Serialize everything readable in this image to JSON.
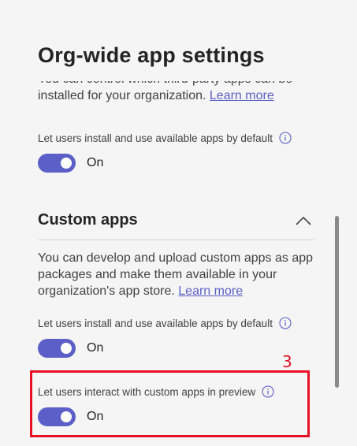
{
  "page": {
    "title": "Org-wide app settings"
  },
  "third_party": {
    "description": "You can control which third-party apps can be installed for your organization.",
    "learn_more": "Learn more",
    "setting_label": "Let users install and use available apps by default",
    "toggle_state": "On",
    "toggle_on": true
  },
  "custom_apps": {
    "heading": "Custom apps",
    "description": "You can develop and upload custom apps as app packages and make them available in your organization's app store.",
    "learn_more": "Learn more",
    "settings": [
      {
        "label": "Let users install and use available apps by default",
        "state": "On",
        "on": true
      },
      {
        "label": "Let users interact with custom apps in preview",
        "state": "On",
        "on": true
      }
    ]
  },
  "annotation": {
    "step_number": "3",
    "color": "#e81123"
  },
  "colors": {
    "accent": "#5b5fc7",
    "background": "#f5f5f5",
    "text": "#242424"
  },
  "icons": {
    "info": "info-circle-icon",
    "collapse": "chevron-up-icon"
  }
}
